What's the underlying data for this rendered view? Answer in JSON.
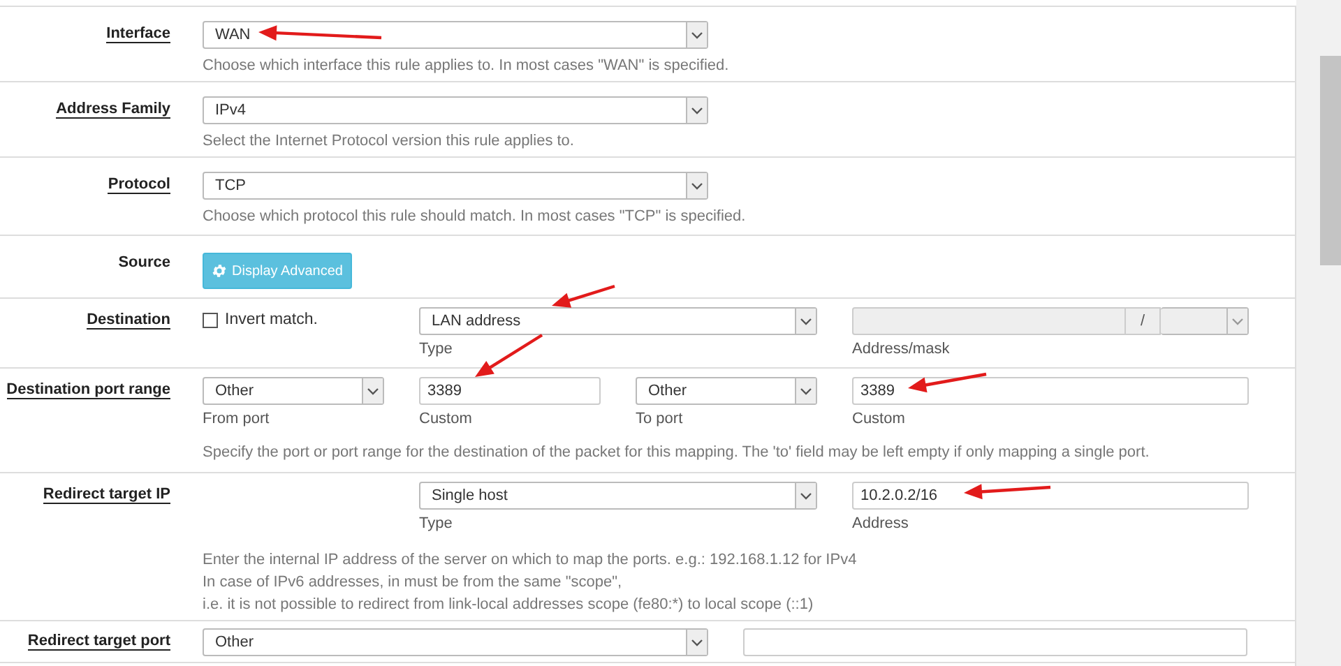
{
  "rows": [
    {
      "kind": "single",
      "label": "Interface",
      "underlined": true,
      "fields": [
        {
          "kind": "select",
          "value": "WAN"
        }
      ],
      "help": [
        "Choose which interface this rule applies to. In most cases \"WAN\" is specified."
      ]
    },
    {
      "kind": "single",
      "label": "Address Family",
      "underlined": true,
      "fields": [
        {
          "kind": "select",
          "value": "IPv4"
        }
      ],
      "help": [
        "Select the Internet Protocol version this rule applies to."
      ]
    },
    {
      "kind": "single",
      "label": "Protocol",
      "underlined": true,
      "fields": [
        {
          "kind": "select",
          "value": "TCP"
        }
      ],
      "help": [
        "Choose which protocol this rule should match. In most cases \"TCP\" is specified."
      ]
    },
    {
      "kind": "single",
      "label": "Source",
      "underlined": false,
      "fields": [
        {
          "kind": "button",
          "label": "Display Advanced"
        }
      ]
    },
    {
      "kind": "grid",
      "label": "Destination",
      "underlined": true,
      "fields": [
        {
          "kind": "checkbox",
          "label": "Invert match.",
          "checked": false
        },
        {
          "kind": "select",
          "value": "LAN address",
          "caption": "Type",
          "wide": true
        },
        {
          "kind": "addrmask",
          "separator": "/",
          "caption": "Address/mask",
          "disabled": true
        }
      ]
    },
    {
      "kind": "grid",
      "label": "Destination port range",
      "underlined": true,
      "fields": [
        {
          "kind": "select",
          "value": "Other",
          "caption": "From port"
        },
        {
          "kind": "input",
          "value": "3389",
          "caption": "Custom"
        },
        {
          "kind": "select",
          "value": "Other",
          "caption": "To port"
        },
        {
          "kind": "input",
          "value": "3389",
          "caption": "Custom"
        }
      ],
      "help": [
        "Specify the port or port range for the destination of the packet for this mapping. The 'to' field may be left empty if only mapping a single port."
      ]
    },
    {
      "kind": "offset_grid",
      "label": "Redirect target IP",
      "underlined": true,
      "fields": [
        {
          "kind": "select",
          "value": "Single host",
          "caption": "Type",
          "wide": true
        },
        {
          "kind": "input",
          "value": "10.2.0.2/16",
          "caption": "Address"
        }
      ],
      "help": [
        "Enter the internal IP address of the server on which to map the ports. e.g.: 192.168.1.12 for IPv4",
        "In case of IPv6 addresses, in must be from the same \"scope\",",
        "i.e. it is not possible to redirect from link-local addresses scope (fe80:*) to local scope (::1)"
      ]
    },
    {
      "kind": "single",
      "label": "Redirect target port",
      "underlined": true,
      "fields": [
        {
          "kind": "select",
          "value": "Other"
        },
        {
          "kind": "input"
        }
      ]
    }
  ]
}
